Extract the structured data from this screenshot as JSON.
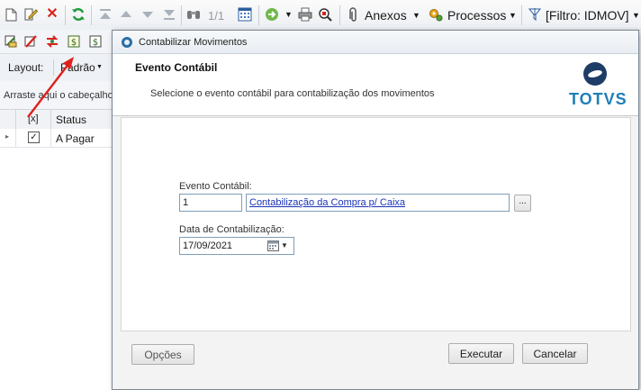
{
  "toolbar": {
    "record_counter": "1/1",
    "attachments_label": "Anexos",
    "processes_label": "Processos",
    "filter_label": "[Filtro: IDMOV]"
  },
  "layout": {
    "label": "Layout:",
    "value": "Padrão"
  },
  "grid": {
    "group_hint": "Arraste aqui o cabeçalho",
    "columns": [
      "[x]",
      "Status"
    ],
    "rows": [
      {
        "checked": true,
        "status": "A Pagar"
      }
    ]
  },
  "dialog": {
    "title": "Contabilizar Movimentos",
    "header_title": "Evento Contábil",
    "header_subtitle": "Selecione o evento contábil para contabilização dos movimentos",
    "brand": "TOTVS",
    "event_label": "Evento Contábil:",
    "event_code": "1",
    "event_description": "Contabilização da Compra p/ Caixa",
    "lookup_label": "...",
    "date_label": "Data de Contabilização:",
    "date_value": "17/09/2021",
    "options_label": "Opções",
    "execute_label": "Executar",
    "cancel_label": "Cancelar"
  },
  "colors": {
    "arrow": "#e0201c",
    "link": "#1a33b8",
    "brand_blue": "#1e7fb8"
  }
}
